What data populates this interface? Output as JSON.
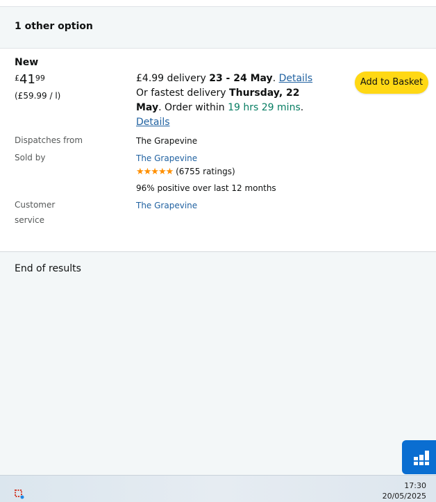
{
  "header": {
    "title": "1 other option"
  },
  "offer": {
    "condition": "New",
    "price": {
      "symbol": "£",
      "whole": "41",
      "fraction": "99"
    },
    "unit_price": "(£59.99 / l)",
    "delivery": {
      "fee": "£4.99 delivery",
      "dates": "23 - 24 May",
      "details_link": "Details",
      "fastest_prefix": "Or fastest delivery",
      "fastest_date": "Thursday, 22 May",
      "order_within_prefix": "Order within",
      "countdown": "19 hrs 29 mins",
      "details_link_2": "Details"
    },
    "add_to_basket_label": "Add to Basket",
    "dispatches_from_label": "Dispatches from",
    "dispatches_from_value": "The Grapevine",
    "sold_by_label": "Sold by",
    "sold_by_value": "The Grapevine",
    "rating_stars": "★★★★★",
    "rating_count": "(6755 ratings)",
    "positive_feedback": "96% positive over last 12 months",
    "customer_service_label_1": "Customer",
    "customer_service_label_2": "service",
    "customer_service_value": "The Grapevine"
  },
  "end_of_results": "End of results",
  "taskbar": {
    "time": "17:30",
    "date": "20/05/2025"
  },
  "colors": {
    "button": "#ffd814",
    "link": "#2162a1",
    "green": "#067d62",
    "star": "#ff8f00",
    "float": "#0a6ed1"
  }
}
